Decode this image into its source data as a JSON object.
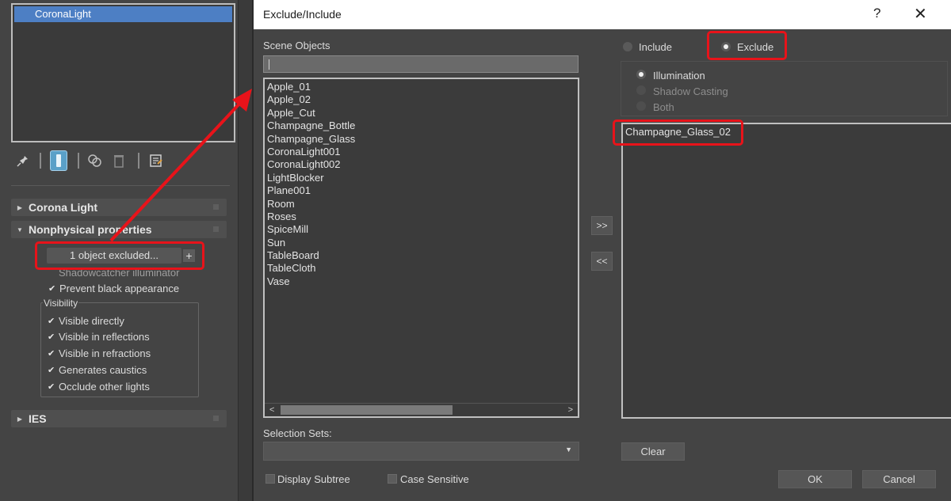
{
  "left_panel": {
    "selected_object": "CoronaLight",
    "toolbar_icons": [
      "pin-icon",
      "modifier-stack-icon",
      "instance-icon",
      "delete-icon",
      "configure-icon"
    ],
    "rollouts": {
      "corona_light": "Corona Light",
      "nonphysical": "Nonphysical properties",
      "ies": "IES"
    },
    "exclude_button": "1 object excluded...",
    "exclude_plus": "+",
    "shadowcatcher": "Shadowcatcher illuminator",
    "prevent_black": "Prevent black appearance",
    "visibility": {
      "label": "Visibility",
      "items": [
        "Visible directly",
        "Visible in reflections",
        "Visible in refractions",
        "Generates caustics",
        "Occlude other lights"
      ]
    }
  },
  "dialog": {
    "title": "Exclude/Include",
    "help": "?",
    "close": "✕",
    "scene_objects_label": "Scene Objects",
    "scene_objects": [
      "Apple_01",
      "Apple_02",
      "Apple_Cut",
      "Champagne_Bottle",
      "Champagne_Glass",
      "CoronaLight001",
      "CoronaLight002",
      "LightBlocker",
      "Plane001",
      "Room",
      "Roses",
      "SpiceMill",
      "Sun",
      "TableBoard",
      "TableCloth",
      "Vase"
    ],
    "selection_sets_label": "Selection Sets:",
    "display_subtree": "Display Subtree",
    "case_sensitive": "Case Sensitive",
    "move_right": ">>",
    "move_left": "<<",
    "mode": {
      "include": "Include",
      "exclude": "Exclude",
      "selected": "Exclude"
    },
    "options": {
      "illumination": "Illumination",
      "shadow_casting": "Shadow Casting",
      "both": "Both",
      "selected": "Illumination"
    },
    "excluded_objects": [
      "Champagne_Glass_02"
    ],
    "clear": "Clear",
    "ok": "OK",
    "cancel": "Cancel"
  },
  "colors": {
    "highlight": "#e8131a",
    "selection": "#4d7fc4",
    "panel_bg": "#444444"
  }
}
